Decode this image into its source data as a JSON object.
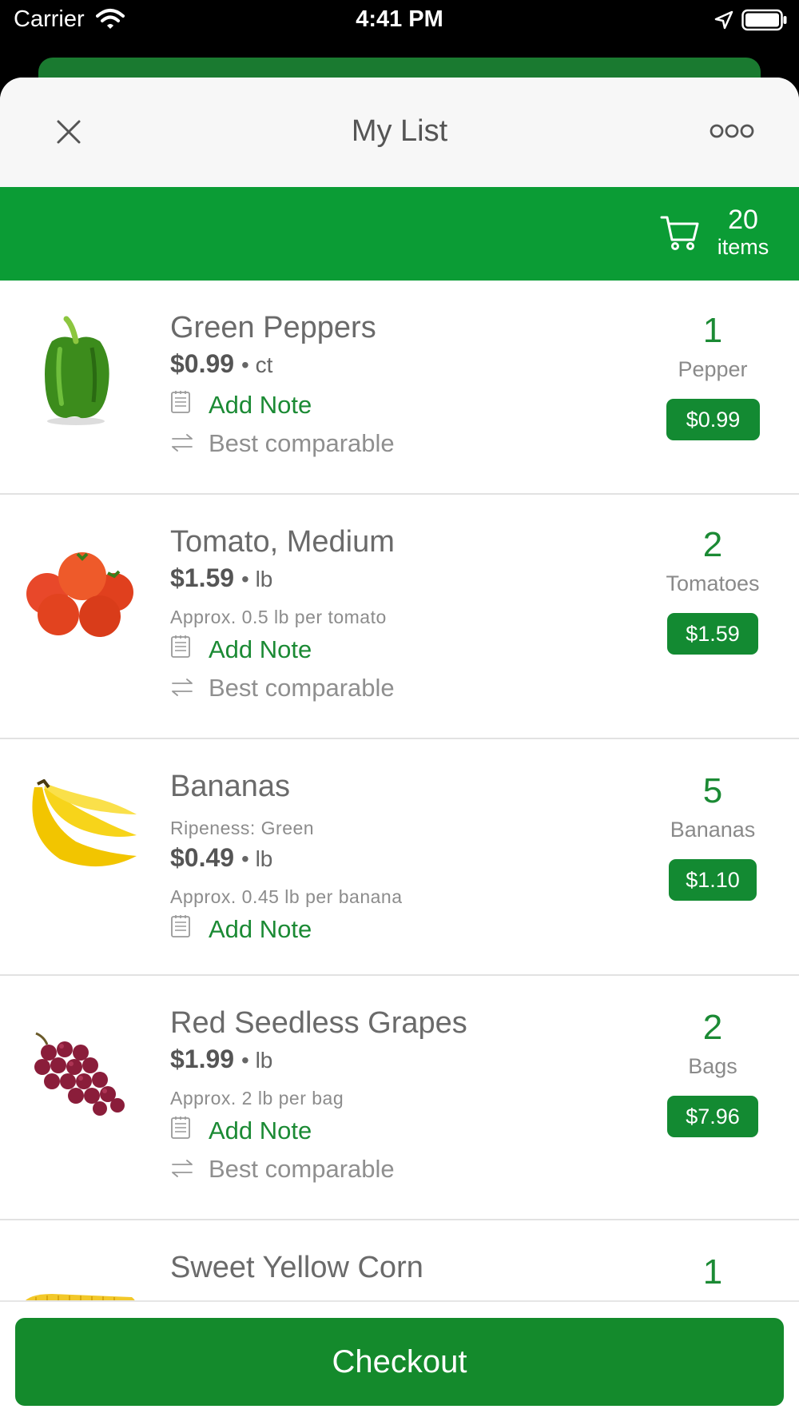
{
  "status_bar": {
    "carrier": "Carrier",
    "time": "4:41 PM"
  },
  "nav": {
    "title": "My List"
  },
  "banner": {
    "count": "20",
    "count_label": "items"
  },
  "items": [
    {
      "name": "Green Peppers",
      "price": "$0.99",
      "unit": "ct",
      "note_label": "Add Note",
      "comparable_label": "Best comparable",
      "qty": "1",
      "qty_unit": "Pepper",
      "total": "$0.99"
    },
    {
      "name": "Tomato, Medium",
      "price": "$1.59",
      "unit": "lb",
      "approx": "Approx. 0.5 lb per tomato",
      "note_label": "Add Note",
      "comparable_label": "Best comparable",
      "qty": "2",
      "qty_unit": "Tomatoes",
      "total": "$1.59"
    },
    {
      "name": "Bananas",
      "ripeness": "Ripeness: Green",
      "price": "$0.49",
      "unit": "lb",
      "approx": "Approx. 0.45 lb per banana",
      "note_label": "Add Note",
      "qty": "5",
      "qty_unit": "Bananas",
      "total": "$1.10"
    },
    {
      "name": "Red Seedless Grapes",
      "price": "$1.99",
      "unit": "lb",
      "approx": "Approx. 2 lb per bag",
      "note_label": "Add Note",
      "comparable_label": "Best comparable",
      "qty": "2",
      "qty_unit": "Bags",
      "total": "$7.96"
    },
    {
      "name": "Sweet Yellow Corn",
      "qty": "1"
    }
  ],
  "checkout": {
    "label": "Checkout"
  },
  "colors": {
    "brand_green": "#0b9c35",
    "button_green": "#148a2c",
    "accent_text_green": "#1b8a34"
  }
}
